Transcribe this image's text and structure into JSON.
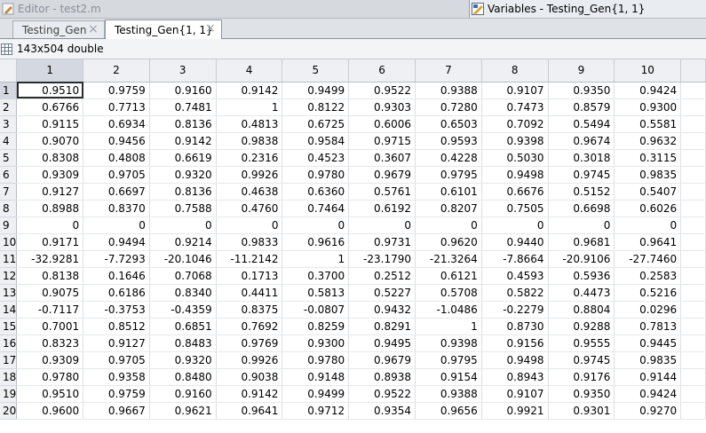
{
  "titlebar": {
    "editor_title": "Editor - test2.m",
    "variables_title": "Variables - Testing_Gen{1, 1}"
  },
  "tabs": [
    {
      "label": "Testing_Gen",
      "close": "×"
    },
    {
      "label": "Testing_Gen{1, 1}",
      "close": "×"
    }
  ],
  "info": {
    "size_label": "143x504 double"
  },
  "icons": [
    "editor-icon",
    "variables-icon",
    "tab-close-icon",
    "grid-icon"
  ],
  "table": {
    "columns": [
      "1",
      "2",
      "3",
      "4",
      "5",
      "6",
      "7",
      "8",
      "9",
      "10"
    ],
    "rows": [
      {
        "label": "1",
        "values": [
          "0.9510",
          "0.9759",
          "0.9160",
          "0.9142",
          "0.9499",
          "0.9522",
          "0.9388",
          "0.9107",
          "0.9350",
          "0.9424"
        ]
      },
      {
        "label": "2",
        "values": [
          "0.6766",
          "0.7713",
          "0.7481",
          "1",
          "0.8122",
          "0.9303",
          "0.7280",
          "0.7473",
          "0.8579",
          "0.9300"
        ]
      },
      {
        "label": "3",
        "values": [
          "0.9115",
          "0.6934",
          "0.8136",
          "0.4813",
          "0.6725",
          "0.6006",
          "0.6503",
          "0.7092",
          "0.5494",
          "0.5581"
        ]
      },
      {
        "label": "4",
        "values": [
          "0.9070",
          "0.9456",
          "0.9142",
          "0.9838",
          "0.9584",
          "0.9715",
          "0.9593",
          "0.9398",
          "0.9674",
          "0.9632"
        ]
      },
      {
        "label": "5",
        "values": [
          "0.8308",
          "0.4808",
          "0.6619",
          "0.2316",
          "0.4523",
          "0.3607",
          "0.4228",
          "0.5030",
          "0.3018",
          "0.3115"
        ]
      },
      {
        "label": "6",
        "values": [
          "0.9309",
          "0.9705",
          "0.9320",
          "0.9926",
          "0.9780",
          "0.9679",
          "0.9795",
          "0.9498",
          "0.9745",
          "0.9835"
        ]
      },
      {
        "label": "7",
        "values": [
          "0.9127",
          "0.6697",
          "0.8136",
          "0.4638",
          "0.6360",
          "0.5761",
          "0.6101",
          "0.6676",
          "0.5152",
          "0.5407"
        ]
      },
      {
        "label": "8",
        "values": [
          "0.8988",
          "0.8370",
          "0.7588",
          "0.4760",
          "0.7464",
          "0.6192",
          "0.8207",
          "0.7505",
          "0.6698",
          "0.6026"
        ]
      },
      {
        "label": "9",
        "values": [
          "0",
          "0",
          "0",
          "0",
          "0",
          "0",
          "0",
          "0",
          "0",
          "0"
        ]
      },
      {
        "label": "10",
        "values": [
          "0.9171",
          "0.9494",
          "0.9214",
          "0.9833",
          "0.9616",
          "0.9731",
          "0.9620",
          "0.9440",
          "0.9681",
          "0.9641"
        ]
      },
      {
        "label": "11",
        "values": [
          "-32.9281",
          "-7.7293",
          "-20.1046",
          "-11.2142",
          "1",
          "-23.1790",
          "-21.3264",
          "-7.8664",
          "-20.9106",
          "-27.7460"
        ]
      },
      {
        "label": "12",
        "values": [
          "0.8138",
          "0.1646",
          "0.7068",
          "0.1713",
          "0.3700",
          "0.2512",
          "0.6121",
          "0.4593",
          "0.5936",
          "0.2583"
        ]
      },
      {
        "label": "13",
        "values": [
          "0.9075",
          "0.6186",
          "0.8340",
          "0.4411",
          "0.5813",
          "0.5227",
          "0.5708",
          "0.5822",
          "0.4473",
          "0.5216"
        ]
      },
      {
        "label": "14",
        "values": [
          "-0.7117",
          "-0.3753",
          "-0.4359",
          "0.8375",
          "-0.0807",
          "0.9432",
          "-1.0486",
          "-0.2279",
          "0.8804",
          "0.0296"
        ]
      },
      {
        "label": "15",
        "values": [
          "0.7001",
          "0.8512",
          "0.6851",
          "0.7692",
          "0.8259",
          "0.8291",
          "1",
          "0.8730",
          "0.9288",
          "0.7813"
        ]
      },
      {
        "label": "16",
        "values": [
          "0.8323",
          "0.9127",
          "0.8483",
          "0.9769",
          "0.9300",
          "0.9495",
          "0.9398",
          "0.9156",
          "0.9555",
          "0.9445"
        ]
      },
      {
        "label": "17",
        "values": [
          "0.9309",
          "0.9705",
          "0.9320",
          "0.9926",
          "0.9780",
          "0.9679",
          "0.9795",
          "0.9498",
          "0.9745",
          "0.9835"
        ]
      },
      {
        "label": "18",
        "values": [
          "0.9780",
          "0.9358",
          "0.8480",
          "0.9038",
          "0.9148",
          "0.8938",
          "0.9154",
          "0.8943",
          "0.9176",
          "0.9144"
        ]
      },
      {
        "label": "19",
        "values": [
          "0.9510",
          "0.9759",
          "0.9160",
          "0.9142",
          "0.9499",
          "0.9522",
          "0.9388",
          "0.9107",
          "0.9350",
          "0.9424"
        ]
      },
      {
        "label": "20",
        "values": [
          "0.9600",
          "0.9667",
          "0.9621",
          "0.9641",
          "0.9712",
          "0.9354",
          "0.9656",
          "0.9921",
          "0.9301",
          "0.9270"
        ]
      }
    ]
  }
}
